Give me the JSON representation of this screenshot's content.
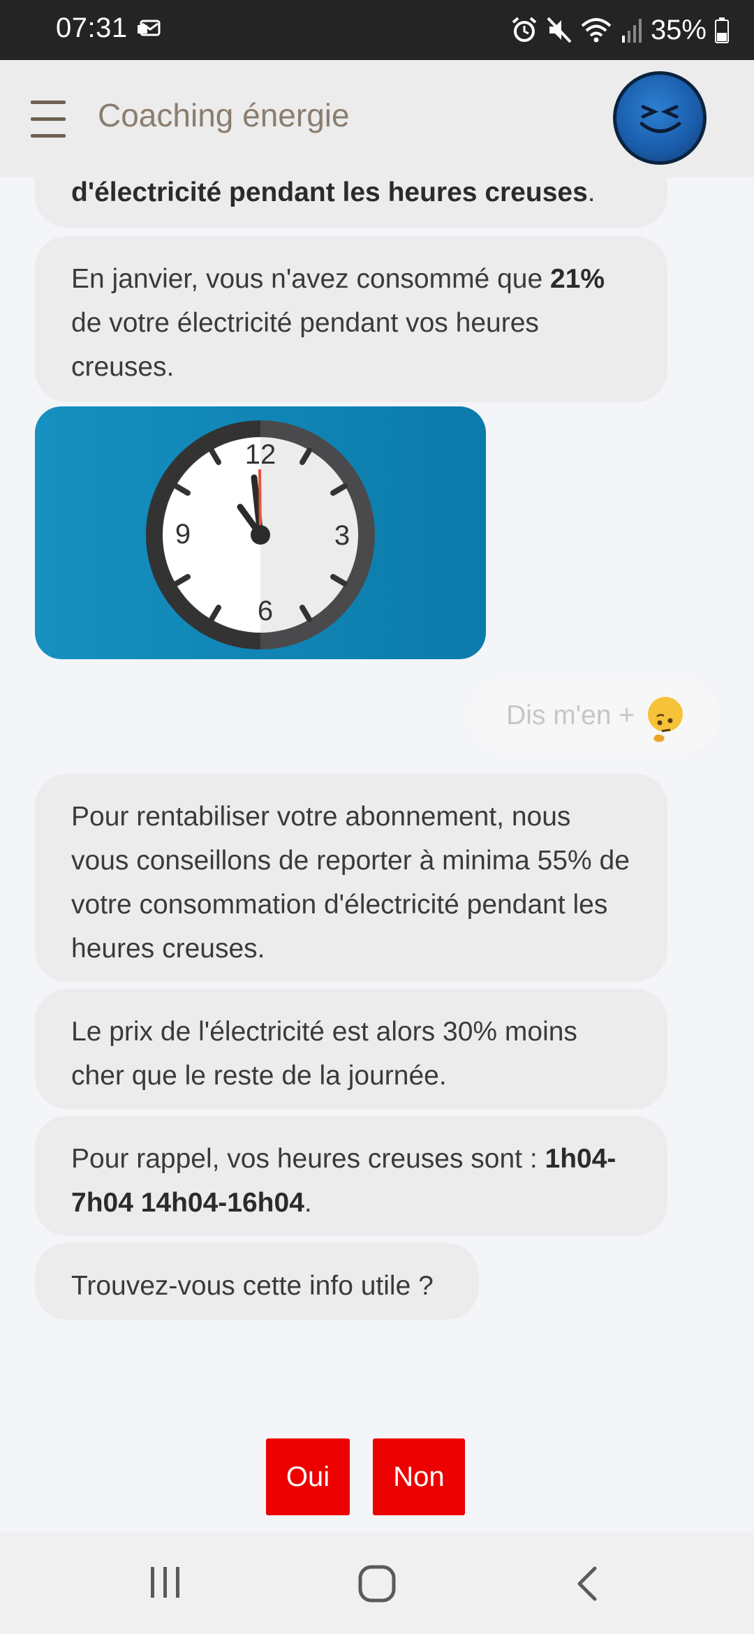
{
  "status_bar": {
    "time": "07:31",
    "battery": "35%"
  },
  "header": {
    "title": "Coaching énergie"
  },
  "chat": {
    "clipped_message": {
      "bold": "d'électricité pendant les heures creuses",
      "after": "."
    },
    "message_january": {
      "before": "En janvier, vous n'avez consommé que ",
      "bold": "21%",
      "after": " de votre électricité pendant vos heures creuses."
    },
    "clock": {
      "numbers": [
        "12",
        "3",
        "6",
        "9"
      ]
    },
    "user_reply": {
      "text": "Dis m'en +",
      "emoji": "thinking-face-icon"
    },
    "message_subscription": "Pour rentabiliser votre abonnement, nous vous conseillons de reporter à minima 55% de votre consommation d'électricité pendant les heures creuses.",
    "message_price": "Le prix de l'électricité est alors 30% moins cher que le reste de la journée.",
    "message_reminder": {
      "before": "Pour rappel, vos heures creuses sont : ",
      "bold": "1h04-7h04 14h04-16h04",
      "after": "."
    },
    "message_question": "Trouvez-vous cette info utile ?"
  },
  "answers": {
    "yes": "Oui",
    "no": "Non"
  },
  "colors": {
    "status_bar": "#242424",
    "header": "#ececec",
    "bubble": "#ececec",
    "clock_card": "#0b7bab",
    "button": "#ed0000"
  }
}
